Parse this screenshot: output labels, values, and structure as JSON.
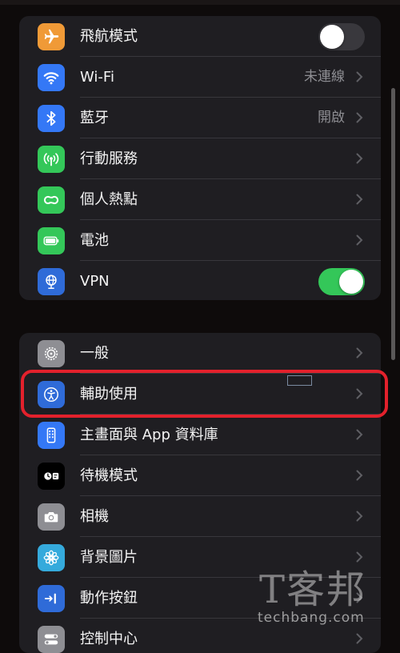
{
  "connectivity": {
    "items": [
      {
        "label": "飛航模式",
        "icon": "airplane-icon",
        "color": "#f09a37"
      },
      {
        "label": "Wi-Fi",
        "value": "未連線",
        "icon": "wifi-icon",
        "color": "#3478f6"
      },
      {
        "label": "藍牙",
        "value": "開啟",
        "icon": "bluetooth-icon",
        "color": "#3478f6"
      },
      {
        "label": "行動服務",
        "icon": "cellular-icon",
        "color": "#34c759"
      },
      {
        "label": "個人熱點",
        "icon": "hotspot-icon",
        "color": "#34c759"
      },
      {
        "label": "電池",
        "icon": "battery-icon",
        "color": "#34c759"
      },
      {
        "label": "VPN",
        "icon": "vpn-globe-icon",
        "color": "#2f6bd8"
      }
    ],
    "airplane_mode_on": false,
    "vpn_on": true
  },
  "general": {
    "items": [
      {
        "label": "一般",
        "icon": "gear-icon",
        "color": "#8e8e93"
      },
      {
        "label": "輔助使用",
        "icon": "accessibility-icon",
        "color": "#2f6bd8"
      },
      {
        "label": "主畫面與 App 資料庫",
        "icon": "home-screen-icon",
        "color": "#3478f6"
      },
      {
        "label": "待機模式",
        "icon": "standby-icon",
        "color": "#000000"
      },
      {
        "label": "相機",
        "icon": "camera-icon",
        "color": "#8e8e93"
      },
      {
        "label": "背景圖片",
        "icon": "wallpaper-flower-icon",
        "color": "#35aadc"
      },
      {
        "label": "動作按鈕",
        "icon": "action-button-icon",
        "color": "#2f6bd8"
      },
      {
        "label": "控制中心",
        "icon": "control-center-icon",
        "color": "#8e8e93"
      }
    ]
  },
  "colors": {
    "highlight": "#e3212c",
    "toggle_on": "#34c759",
    "toggle_off": "#39383d"
  },
  "watermark": {
    "logo": "T客邦",
    "site": "techbang.com"
  }
}
